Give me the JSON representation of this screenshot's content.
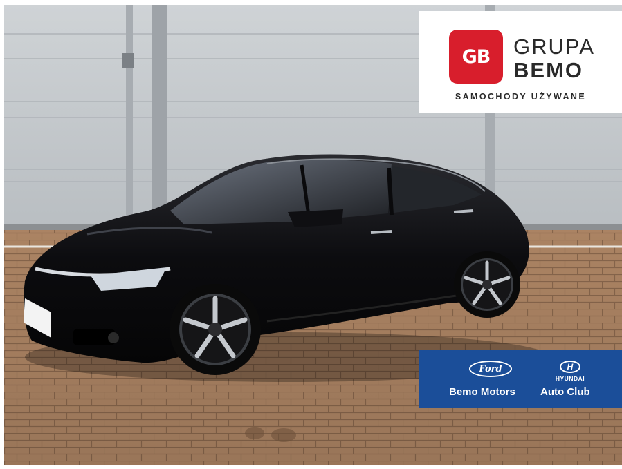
{
  "logo": {
    "badge_text": "GB",
    "line1": "GRUPA",
    "line2": "BEMO",
    "tagline": "SAMOCHODY UŻYWANE",
    "badge_color": "#d81e2c"
  },
  "dealers": {
    "panel_color": "#1b4e99",
    "ford_badge": "Ford",
    "hyundai_badge": "H",
    "hyundai_word": "HYUNDAI",
    "name_1": "Bemo Motors",
    "name_2": "Auto Club"
  },
  "photo": {
    "subject": "black-sedan",
    "car_color": "#0b0b0d",
    "wall_color": "#c4c8cc",
    "pavement_color": "#b48a68"
  }
}
